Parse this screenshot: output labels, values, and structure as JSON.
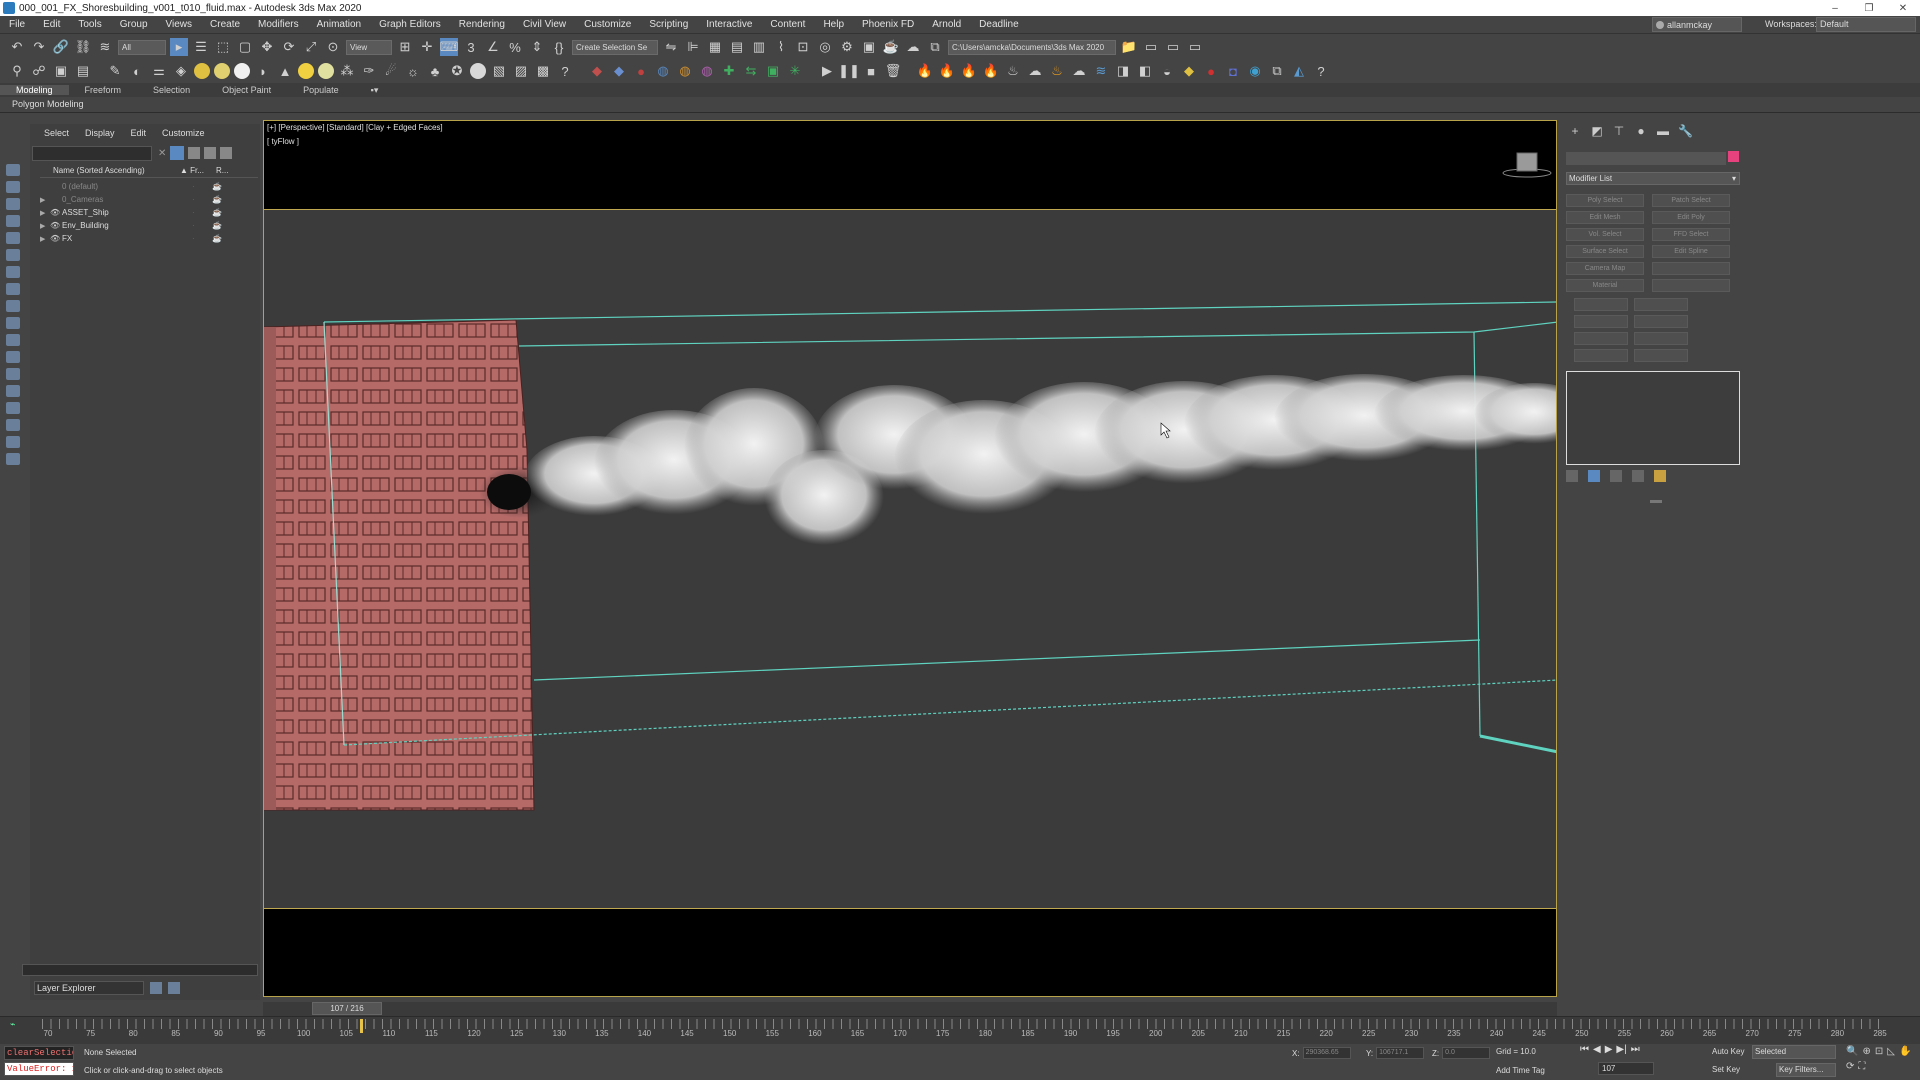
{
  "window": {
    "title": "000_001_FX_Shoresbuilding_v001_t010_fluid.max - Autodesk 3ds Max 2020",
    "controls": [
      "–",
      "❐",
      "✕"
    ]
  },
  "menubar": {
    "items": [
      "File",
      "Edit",
      "Tools",
      "Group",
      "Views",
      "Create",
      "Modifiers",
      "Animation",
      "Graph Editors",
      "Rendering",
      "Civil View",
      "Customize",
      "Scripting",
      "Interactive",
      "Content",
      "Help",
      "Phoenix FD",
      "Arnold",
      "Deadline"
    ],
    "user": "allanmckay",
    "workspaces_label": "Workspaces:",
    "workspace": "Default"
  },
  "toolbar1": {
    "filter": "All",
    "refcoord": "View",
    "selection_set": "Create Selection Se",
    "project_path": "C:\\Users\\amcka\\Documents\\3ds Max 2020"
  },
  "ribbon": {
    "tabs": [
      "Modeling",
      "Freeform",
      "Selection",
      "Object Paint",
      "Populate"
    ],
    "panel_label": "Polygon Modeling"
  },
  "explorer": {
    "menu": [
      "Select",
      "Display",
      "Edit",
      "Customize"
    ],
    "col_name": "Name (Sorted Ascending)",
    "col_frozen": "▲ Fr...",
    "col_render": "R...",
    "rows": [
      {
        "name": "0 (default)",
        "dim": true
      },
      {
        "name": "0_Cameras",
        "dim": true
      },
      {
        "name": "ASSET_Ship",
        "dim": false
      },
      {
        "name": "Env_Building",
        "dim": false
      },
      {
        "name": "FX",
        "dim": false
      }
    ],
    "footer": "Layer Explorer"
  },
  "viewport": {
    "label": "[+] [Perspective] [Standard] [Clay + Edged Faces]",
    "sublabel": "[ tyFlow ]"
  },
  "cmdpanel": {
    "modifier_list": "Modifier List",
    "buttons": [
      "Poly Select",
      "Patch Select",
      "Edit Mesh",
      "Edit Poly",
      "Vol. Select",
      "FFD Select",
      "Surface Select",
      "Edit Spline",
      "Camera Map",
      "",
      "Material",
      ""
    ]
  },
  "timeline": {
    "frame": "107 / 216",
    "ticks": [
      70,
      75,
      80,
      85,
      90,
      95,
      100,
      105,
      110,
      115,
      120,
      125,
      130,
      135,
      140,
      145,
      150,
      155,
      160,
      165,
      170,
      175,
      180,
      185,
      190,
      195,
      200,
      205,
      210,
      215,
      220,
      225,
      230,
      235,
      240,
      245,
      250,
      255,
      260,
      265,
      270,
      275,
      280,
      285
    ]
  },
  "status": {
    "maxscript_1": "clearSelectio",
    "maxscript_2": "ValueError: 1",
    "selection": "None Selected",
    "prompt": "Click or click-and-drag to select objects",
    "x_label": "X:",
    "x_value": "290368.65",
    "y_label": "Y:",
    "y_value": "106717.1",
    "z_label": "Z:",
    "z_value": "0.0",
    "grid": "Grid = 10.0",
    "add_time_tag": "Add Time Tag",
    "current_frame": "107",
    "auto_key": "Auto Key",
    "set_key": "Set Key",
    "selected": "Selected",
    "key_filters": "Key Filters..."
  },
  "colors": {
    "viewport_border": "#b8a24a",
    "building": "#b56a68",
    "sim_box": "#5fd3c0",
    "smoke": "#d9d9d9",
    "accent": "#e6427e"
  }
}
